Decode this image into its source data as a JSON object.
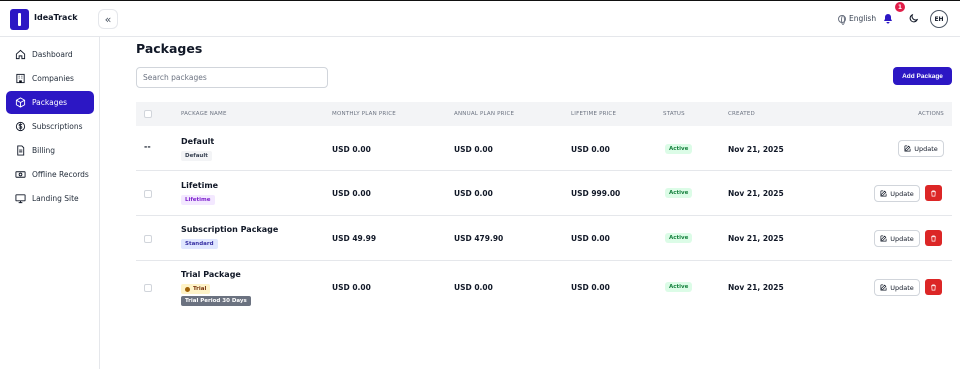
{
  "app": {
    "name": "IdeaTrack"
  },
  "header": {
    "language": "English",
    "notification_count": "1",
    "user_initials": "EH"
  },
  "sidebar": {
    "items": [
      {
        "label": "Dashboard",
        "icon": "home-icon"
      },
      {
        "label": "Companies",
        "icon": "building-icon"
      },
      {
        "label": "Packages",
        "icon": "box-icon",
        "active": true
      },
      {
        "label": "Subscriptions",
        "icon": "dollar-icon"
      },
      {
        "label": "Billing",
        "icon": "document-icon"
      },
      {
        "label": "Offline Records",
        "icon": "cash-icon"
      },
      {
        "label": "Landing Site",
        "icon": "monitor-icon"
      }
    ]
  },
  "page": {
    "title": "Packages",
    "search_placeholder": "Search packages",
    "add_label": "Add Package"
  },
  "table": {
    "columns": [
      "Package Name",
      "Monthly Plan Price",
      "Annual Plan Price",
      "Lifetime Price",
      "Status",
      "Created",
      "Actions"
    ],
    "update_label": "Update",
    "rows": [
      {
        "name": "Default",
        "tags": [
          "Default"
        ],
        "monthly": "USD 0.00",
        "annual": "USD 0.00",
        "lifetime": "USD 0.00",
        "status": "Active",
        "created": "Nov 21, 2025",
        "marker": "--"
      },
      {
        "name": "Lifetime",
        "tags": [
          "Lifetime"
        ],
        "monthly": "USD 0.00",
        "annual": "USD 0.00",
        "lifetime": "USD 999.00",
        "status": "Active",
        "created": "Nov 21, 2025"
      },
      {
        "name": "Subscription Package",
        "tags": [
          "Standard"
        ],
        "monthly": "USD 49.99",
        "annual": "USD 479.90",
        "lifetime": "USD 0.00",
        "status": "Active",
        "created": "Nov 21, 2025"
      },
      {
        "name": "Trial Package",
        "tags": [
          "Trial",
          "Trial Period 30 Days"
        ],
        "monthly": "USD 0.00",
        "annual": "USD 0.00",
        "lifetime": "USD 0.00",
        "status": "Active",
        "created": "Nov 21, 2025"
      }
    ]
  },
  "colors": {
    "brand": "#2c17c4",
    "danger": "#dc2626",
    "success_bg": "#dcfce7",
    "success_text": "#15803d"
  }
}
